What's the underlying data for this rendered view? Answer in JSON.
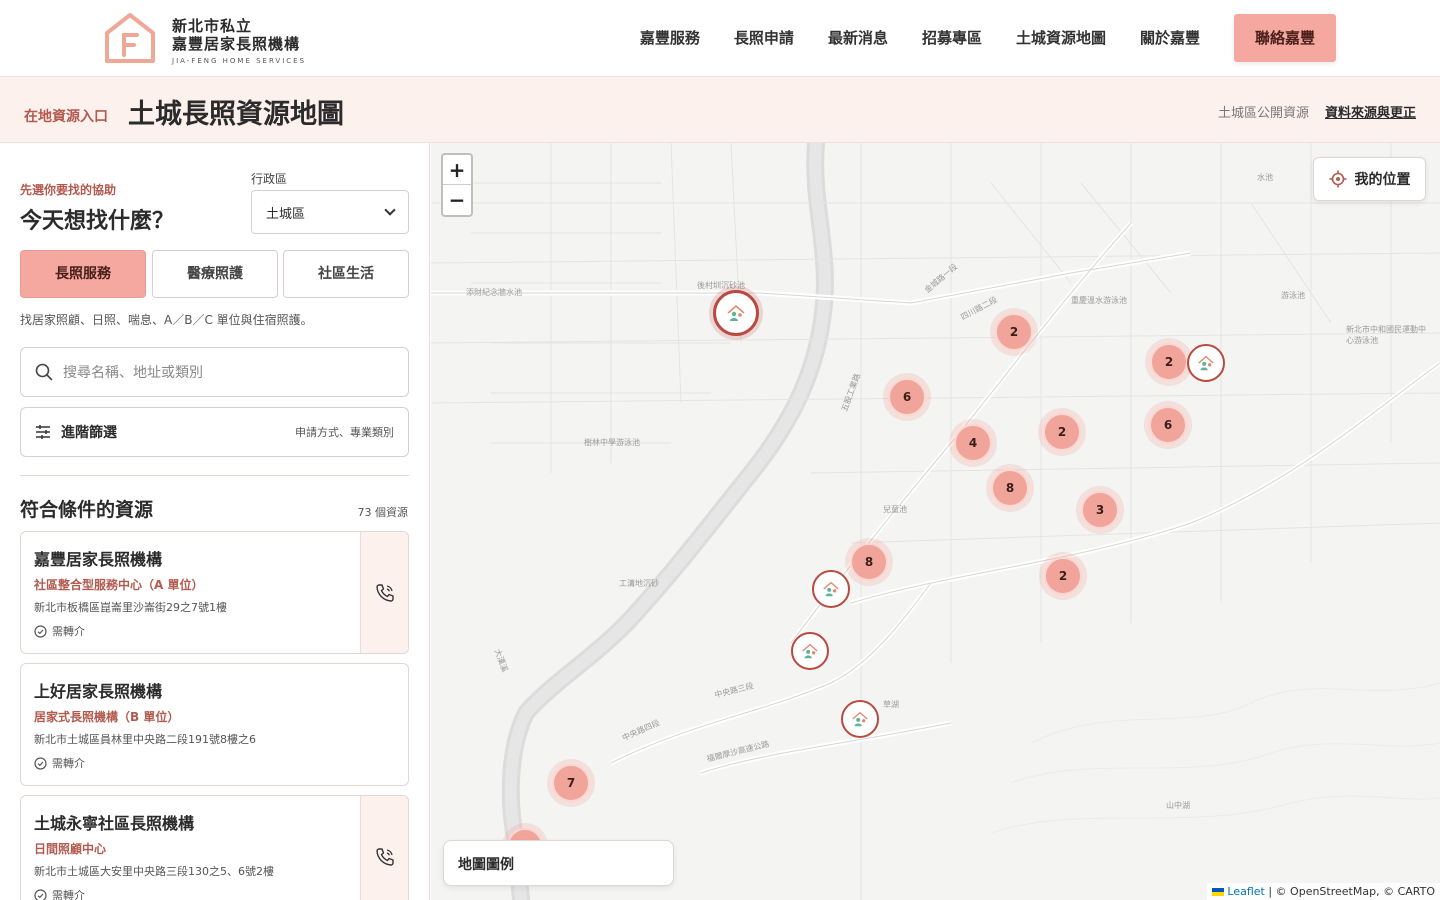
{
  "brand": {
    "line1": "新北市私立",
    "line2": "嘉豐居家長照機構",
    "sub": "JIA-FENG HOME SERVICES"
  },
  "nav": {
    "items": [
      "嘉豐服務",
      "長照申請",
      "最新消息",
      "招募專區",
      "土城資源地圖",
      "關於嘉豐"
    ],
    "cta": "聯絡嘉豐"
  },
  "subheader": {
    "kicker": "在地資源入口",
    "title": "土城長照資源地圖",
    "source_label": "土城區公開資源",
    "source_link": "資料來源與更正"
  },
  "sidebar": {
    "kicker": "先選你要找的協助",
    "question": "今天想找什麼？",
    "district_label": "行政區",
    "district_value": "土城區",
    "categories": [
      "長照服務",
      "醫療照護",
      "社區生活"
    ],
    "category_desc": "找居家照顧、日照、喘息、A／B／C 單位與住宿照護。",
    "search_placeholder": "搜尋名稱、地址或類別",
    "filter_label": "進階篩選",
    "filter_hint": "申請方式、專業類別",
    "results_title": "符合條件的資源",
    "results_count": "73 個資源",
    "cards": [
      {
        "name": "嘉豐居家長照機構",
        "type": "社區整合型服務中心（A 單位）",
        "address": "新北市板橋區崑崙里沙崙街29之7號1樓",
        "note": "需轉介"
      },
      {
        "name": "上好居家長照機構",
        "type": "居家式長照機構（B 單位）",
        "address": "新北市土城區員林里中央路二段191號8樓之6",
        "note": "需轉介"
      },
      {
        "name": "土城永寧社區長照機構",
        "type": "日間照顧中心",
        "address": "新北市土城區大安里中央路三段130之5、6號2樓",
        "note": "需轉介"
      }
    ]
  },
  "map": {
    "zoom_in": "+",
    "zoom_out": "−",
    "my_location": "我的位置",
    "legend": "地圖圖例",
    "attribution_leaflet": "Leaflet",
    "attribution_rest": " | © OpenStreetMap, © CARTO",
    "clusters": [
      "2",
      "6",
      "4",
      "2",
      "8",
      "3",
      "2",
      "2",
      "6",
      "8",
      "7"
    ],
    "labels": [
      "添財紀念牆水池",
      "後村圳沉砂池",
      "重慶溫水游泳池",
      "游泳池",
      "新北市中和國民運動中心游泳池",
      "水池",
      "樹林中學游泳池",
      "兒童池",
      "工溝地沉砂",
      "草湖",
      "山中湖",
      "中央路三段",
      "中央路四段",
      "福爾摩沙高速公路",
      "大漢溪",
      "金城路一段",
      "五股工業路",
      "四川路二段"
    ]
  },
  "colors": {
    "accent": "#f4a89f",
    "accent_text": "#b35a4f",
    "pin_border": "#b94a40",
    "subheader_bg": "#fdf1ee"
  }
}
